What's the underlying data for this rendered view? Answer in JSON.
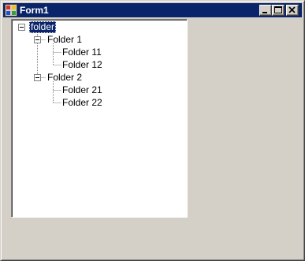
{
  "window": {
    "title": "Form1"
  },
  "title_buttons": {
    "minimize_icon": "minimize-icon",
    "maximize_icon": "maximize-icon",
    "close_icon": "close-icon"
  },
  "tree": {
    "root": {
      "label": "folder",
      "expanded": true,
      "selected": true
    },
    "folder1": {
      "label": "Folder 1",
      "expanded": true
    },
    "folder11": {
      "label": "Folder 11"
    },
    "folder12": {
      "label": "Folder 12"
    },
    "folder2": {
      "label": "Folder 2",
      "expanded": true
    },
    "folder21": {
      "label": "Folder 21"
    },
    "folder22": {
      "label": "Folder 22"
    }
  },
  "colors": {
    "titlebar": "#0a246a",
    "form_background": "#d4d0c8",
    "selection": "#0a246a"
  }
}
